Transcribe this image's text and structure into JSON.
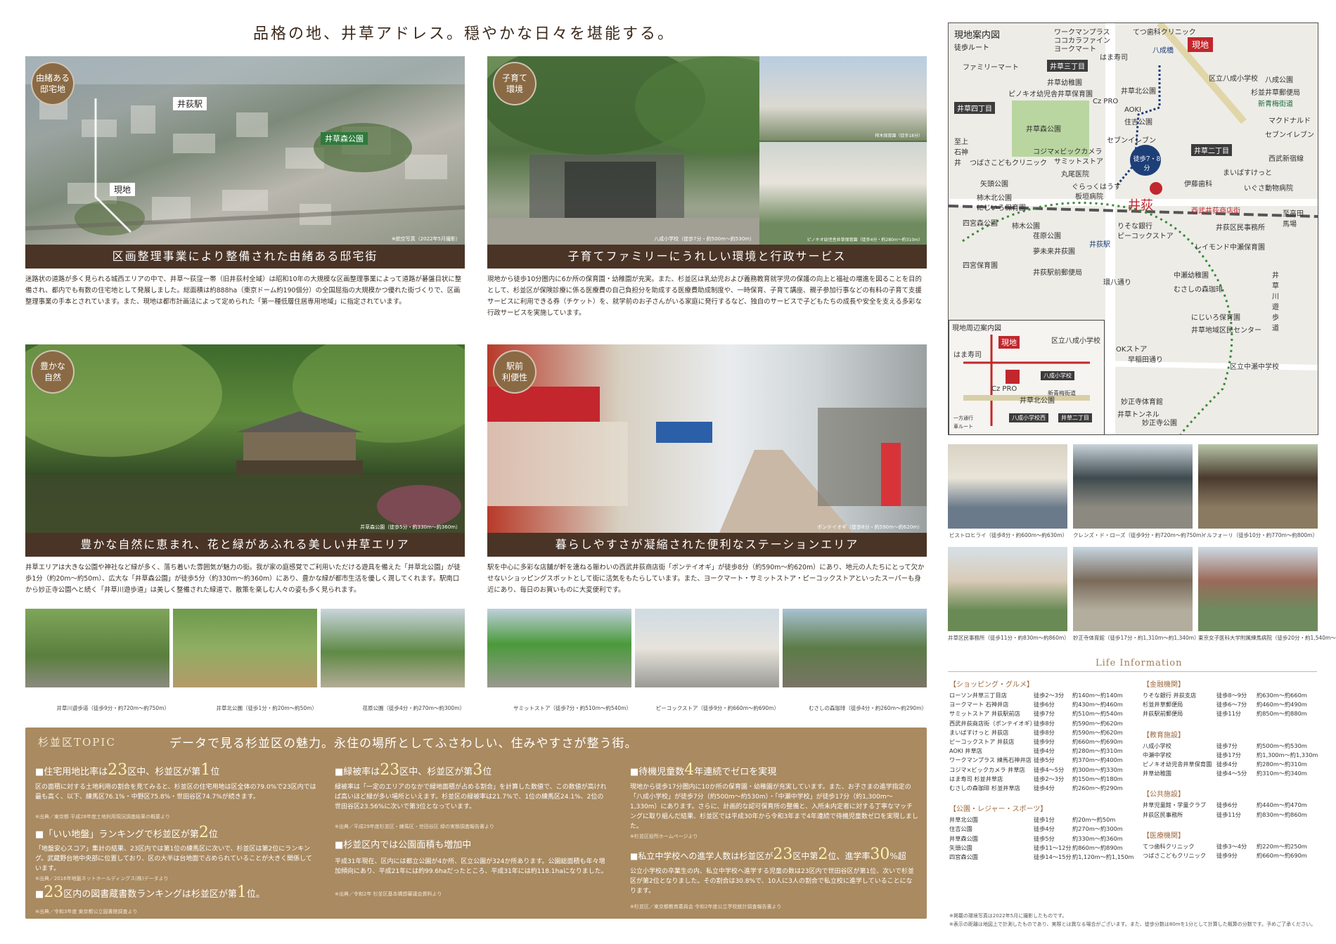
{
  "main_title": "品格の地、井草アドレス。穏やかな日々を堪能する。",
  "panels": [
    {
      "badge": "由緒ある\n邸宅地",
      "caption": "区画整理事業により整備された由緒ある邸宅街",
      "photo_labels": {
        "station": "井荻駅",
        "park": "井草森公園",
        "site": "現地"
      },
      "photo_note": "※航空写真（2022年5月撮影）",
      "body": "迷路状の道路が多く見られる城西エリアの中で、井草～荻窪一帯（旧井荻村全域）は昭和10年の大規模な区画整理事業によって道路が碁盤目状に整備され、都内でも有数の住宅地として発展しました。総面積は約888ha（東京ドーム約190個分）の全国屈指の大規模かつ優れた街づくりで、区画整理事業の手本とされています。また、現地は都市計画法によって定められた「第一種低層住居専用地域」に指定されています。"
    },
    {
      "badge": "子育て\n環境",
      "caption": "子育てファミリーにうれしい環境と行政サービス",
      "photo_note": "八成小学校（徒歩7分・約500m～約530m）",
      "photo_note2": "柿木保育園（徒歩18分）",
      "photo_note3": "ピノキオ幼児舎井草保育園（徒歩4分・約280m～約310m）",
      "body": "現地から徒歩10分圏内に6か所の保育園・幼稚園が充実。また、杉並区は乳幼児および義務教育就学児の保護の向上と福祉の増進を図ることを目的として、杉並区が保険診療に係る医療費の自己負担分を助成する医療費助成制度や、一時保育、子育て講座、親子参加行事などの有料の子育て支援サービスに利用できる券（チケット）を、就学前のお子さんがいる家庭に発行するなど、独自のサービスで子どもたちの成長や安全を支える多彩な行政サービスを実施しています。"
    },
    {
      "badge": "豊かな\n自然",
      "caption": "豊かな自然に恵まれ、花と緑があふれる美しい井草エリア",
      "photo_note": "井草森公園（徒歩5分・約330m～約360m）",
      "body": "井草エリアは大きな公園や神社など緑が多く、落ち着いた雰囲気が魅力の街。我が家の庭感覚でご利用いただける遊具を備えた「井草北公園」が徒歩1分（約20m～約50m）、広大な「井草森公園」が徒歩5分（約330m～約360m）にあり、豊かな緑が都市生活を優しく潤してくれます。駅南口から妙正寺公園へと続く「井草川遊歩道」は美しく整備された緑道で、散策を楽しむ人々の姿も多く見られます。"
    },
    {
      "badge": "駅前\n利便性",
      "caption": "暮らしやすさが凝縮された便利なステーションエリア",
      "photo_note": "ポンテイオギ（徒歩8分・約590m～約620m）",
      "body": "駅を中心に多彩な店舗が軒を連ねる賑わいの西武井荻商店街「ポンテイオギ」が徒歩8分（約590m～約620m）にあり、地元の人たちにとって欠かせないショッピングスポットとして街に活気をもたらしています。また、ヨークマート・サミットストア・ピーコックストアといったスーパーも身近にあり、毎日のお買いものに大変便利です。"
    }
  ],
  "small_photos": [
    "井草川遊歩道（徒歩9分・約720m～約750m）",
    "井草北公園（徒歩1分・約20m～約50m）",
    "荏原公園（徒歩4分・約270m～約300m）",
    "サミットストア（徒歩7分・約510m～約540m）",
    "ピーコックストア（徒歩9分・約660m～約690m）",
    "むさしの森珈琲（徒歩4分・約260m～約290m）"
  ],
  "topic": {
    "label": "杉並区TOPIC",
    "headline": "データで見る杉並区の魅力。永住の場所としてふさわしい、住みやすさが整う街。",
    "items": [
      {
        "title_pre": "■住宅用地比率は",
        "num1": "23",
        "title_mid": "区中、杉並区が第",
        "num2": "1",
        "title_post": "位",
        "body": "区の面積に対する土地利用の割合を見てみると、杉並区の住宅用地は区全体の79.0%で23区内では最も高く、以下、練馬区76.1%・中野区75.8%・世田谷区74.7%が続きます。",
        "src": "※出典／東京都 平成28年度土地利用現況調査結果の概要より"
      },
      {
        "title_pre": "■「いい地盤」ランキングで杉並区が第",
        "num2": "2",
        "title_post": "位",
        "body": "「地盤安心スコア」集計の結果、23区内では第1位の練馬区に次いで、杉並区は第2位にランキング。武蔵野台地中央部に位置しており、区の大半は台地面で占められていることが大きく関係しています。",
        "src": "※出典／2016年地盤ネットホールディングス(株)データより"
      },
      {
        "title_pre": "■",
        "num1": "23",
        "title_mid": "区内の図書蔵書数ランキングは杉並区が第",
        "num2": "1",
        "title_post": "位。",
        "src": "※出典／令和3年度 東京都公立図書館調査より"
      },
      {
        "title_pre": "■緑被率は",
        "num1": "23",
        "title_mid": "区中、杉並区が第",
        "num2": "3",
        "title_post": "位",
        "body": "緑被率は「一定のエリアのなかで緑地面積が占める割合」を計算した数値で、この数値が高ければ高いほど緑が多い場所といえます。杉並区の緑被率は21.7%で、1位の練馬区24.1%、2位の世田谷区23.56%に次いで第3位となっています。",
        "src": "※出典／平成29年度杉並区・練馬区・世田谷区 緑の実態調査報告書より"
      },
      {
        "title_pre": "■杉並区内では公園面積も増加中",
        "body": "平成31年現在、区内には都立公園が4か所、区立公園が324か所あります。公園総面積も年々増加傾向にあり、平成21年には約99.6haだったところ、平成31年には約118.1haになりました。",
        "src": "※出典／令和2年 杉並区基本構想審議会資料より"
      },
      {
        "title_pre": "■待機児童数",
        "num1": "4",
        "title_mid": "年連続でゼロを実現",
        "body": "現地から徒歩17分圏内に10か所の保育園・幼稚園が充実しています。また、お子さまの進学指定の「八成小学校」が徒歩7分（約500m～約530m）・「中瀬中学校」が徒歩17分（約1,300m～1,330m）にあります。さらに、計画的な認可保育所の整備と、入所未内定者に対する丁寧なマッチングに取り組んだ結果、杉並区では平成30年から令和3年まで4年連続で待機児童数ゼロを実現しました。",
        "src": "※杉並区役所ホームページより"
      },
      {
        "title_pre": "■私立中学校への進学人数は杉並区が",
        "num1": "23",
        "title_mid": "区中第",
        "num2": "2",
        "title_post": "位、進学率",
        "num3": "30",
        "title_end": "%超",
        "body": "公立小学校の卒業生の内、私立中学校へ進学する児童の数は23区内で世田谷区が第1位、次いで杉並区が第2位となりました。その割合は30.8%で、10人に3人の割合で私立校に進学していることになります。",
        "src": "※杉並区／東京都教育委員会 令和2年度公立学校統計調査報告書より"
      }
    ]
  },
  "map": {
    "title": "現地案内図",
    "route_legend": "徒歩ルート",
    "walk_badge": "徒歩7・8分",
    "site": "現地",
    "station": "井荻",
    "labels": [
      "ワークマンプラス",
      "ココカラファイン",
      "ヨークマート",
      "てつ歯科クリニック",
      "はま寿司",
      "ファミリーマート",
      "井草三丁目",
      "井草四丁目",
      "井草幼稚園",
      "ピノキオ幼児舎井草保育園",
      "井草森公園",
      "井草北公園",
      "AOKI",
      "住吉公園",
      "区立八成小学校",
      "杉並井草郵便局",
      "新青梅街道",
      "八成公園",
      "マクドナルド",
      "井草二丁目",
      "セブンイレブン",
      "西武新宿線",
      "コジマ×ビックカメラ",
      "サミットストア",
      "丸尾医院",
      "つばさこどもクリニック",
      "矢頭公園",
      "柿木北公園",
      "にじいろ保育園",
      "四宮森公園",
      "柿木公園",
      "荏原公園",
      "りそな銀行",
      "ピーコックストア",
      "伊藤歯科",
      "まいばすけっと",
      "いぐさ動物病院",
      "西武井荻商店街",
      "井荻区民事務所",
      "至高田馬場",
      "レイモンド中瀬保育園",
      "夢未来井荻園",
      "井荻駅前郵便局",
      "中瀬幼稚園",
      "むさしの森珈琲",
      "環八通り",
      "にじいろ保育園",
      "井草地域区民センター",
      "早稲田通り",
      "OKストア",
      "区立中瀬中学校",
      "妙正寺体育館",
      "妙正寺公園",
      "井草トンネル",
      "至上石神井",
      "四宮保育園",
      "井草川遊歩道",
      "八成橋",
      "井荻駅",
      "Cz PRO",
      "セブンイレブン",
      "板垣病院",
      "ぐらっくはうす"
    ],
    "inset": {
      "title": "現地周辺案内図",
      "labels": [
        "現地",
        "はま寿司",
        "区立八成小学校",
        "八成小学校",
        "Cz PRO",
        "井草北公園",
        "八成小学校西",
        "井草二丁目",
        "新青梅街道"
      ],
      "legend": [
        "一方通行",
        "車ルート"
      ]
    }
  },
  "life_photos": [
    "ビストロヒライ（徒歩8分・約600m～約630m）",
    "クレンズ・ド・ローズ（徒歩9分・約720m～約750m）",
    "イルフォーリ（徒歩10分・約770m～約800m）",
    "井草区民事務所（徒歩11分・約830m～約860m）",
    "妙正寺体育館（徒歩17分・約1,310m～約1,340m）",
    "東京女子医科大学附属練馬病院（徒歩20分・約1,540m～約1,570m）"
  ],
  "life_info": {
    "title": "Life Information",
    "categories": [
      {
        "name": "【ショッピング・グルメ】",
        "rows": [
          [
            "ローソン井草三丁目店",
            "徒歩2～3分",
            "約140m～約140m"
          ],
          [
            "ヨークマート 石神井店",
            "徒歩6分",
            "約430m～約460m"
          ],
          [
            "サミットストア 井荻駅前店",
            "徒歩7分",
            "約510m～約540m"
          ],
          [
            "西武井荻商店街（ポンテイオギ）",
            "徒歩8分",
            "約590m～約620m"
          ],
          [
            "まいばすけっと 井荻店",
            "徒歩8分",
            "約590m～約620m"
          ],
          [
            "ピーコックストア 井荻店",
            "徒歩9分",
            "約660m～約690m"
          ],
          [
            "AOKI 井草店",
            "徒歩4分",
            "約280m～約310m"
          ],
          [
            "ワークマンプラス 練馬石神井店",
            "徒歩5分",
            "約370m～約400m"
          ],
          [
            "コジマ×ビックカメラ 井草店",
            "徒歩4～5分",
            "約300m～約330m"
          ],
          [
            "はま寿司 杉並井草店",
            "徒歩2～3分",
            "約150m～約180m"
          ],
          [
            "むさしの森珈琲 杉並井草店",
            "徒歩4分",
            "約260m～約290m"
          ]
        ]
      },
      {
        "name": "【公園・レジャー・スポーツ】",
        "rows": [
          [
            "井草北公園",
            "徒歩1分",
            "約20m～約50m"
          ],
          [
            "住吉公園",
            "徒歩4分",
            "約270m～約300m"
          ],
          [
            "井草森公園",
            "徒歩5分",
            "約330m～約360m"
          ],
          [
            "矢頭公園",
            "徒歩11～12分",
            "約860m～約890m"
          ],
          [
            "四宮森公園",
            "徒歩14～15分",
            "約1,120m～約1,150m"
          ]
        ]
      },
      {
        "name": "【金融機関】",
        "rows": [
          [
            "りそな銀行 井荻支店",
            "徒歩8～9分",
            "約630m～約660m"
          ],
          [
            "杉並井草郵便局",
            "徒歩6～7分",
            "約460m～約490m"
          ],
          [
            "井荻駅前郵便局",
            "徒歩11分",
            "約850m～約880m"
          ]
        ]
      },
      {
        "name": "【教育施設】",
        "rows": [
          [
            "八成小学校",
            "徒歩7分",
            "約500m～約530m"
          ],
          [
            "中瀬中学校",
            "徒歩17分",
            "約1,300m～約1,330m"
          ],
          [
            "ピノキオ幼児舎井草保育園",
            "徒歩4分",
            "約280m～約310m"
          ],
          [
            "井草幼稚園",
            "徒歩4～5分",
            "約310m～約340m"
          ]
        ]
      },
      {
        "name": "【公共施設】",
        "rows": [
          [
            "井草児童館・学童クラブ",
            "徒歩6分",
            "約440m～約470m"
          ],
          [
            "井荻区民事務所",
            "徒歩11分",
            "約830m～約860m"
          ]
        ]
      },
      {
        "name": "【医療機関】",
        "rows": [
          [
            "てつ歯科クリニック",
            "徒歩3～4分",
            "約220m～約250m"
          ],
          [
            "つばさこどもクリニック",
            "徒歩9分",
            "約660m～約690m"
          ]
        ]
      }
    ],
    "notes": [
      "※掲載の環境写真は2022年5月に撮影したものです。",
      "※表示の距離は地図上で計測したものであり、実際とは異なる場合がございます。また、徒歩分数は80mを1分として計算した概算の分数です。予めご了承ください。"
    ]
  },
  "colors": {
    "brown_bar": "#4a3426",
    "topic_bg": "#a98a61",
    "badge": "#8a6a44",
    "accent_red": "#c1272d",
    "life_head": "#9c6b42"
  }
}
